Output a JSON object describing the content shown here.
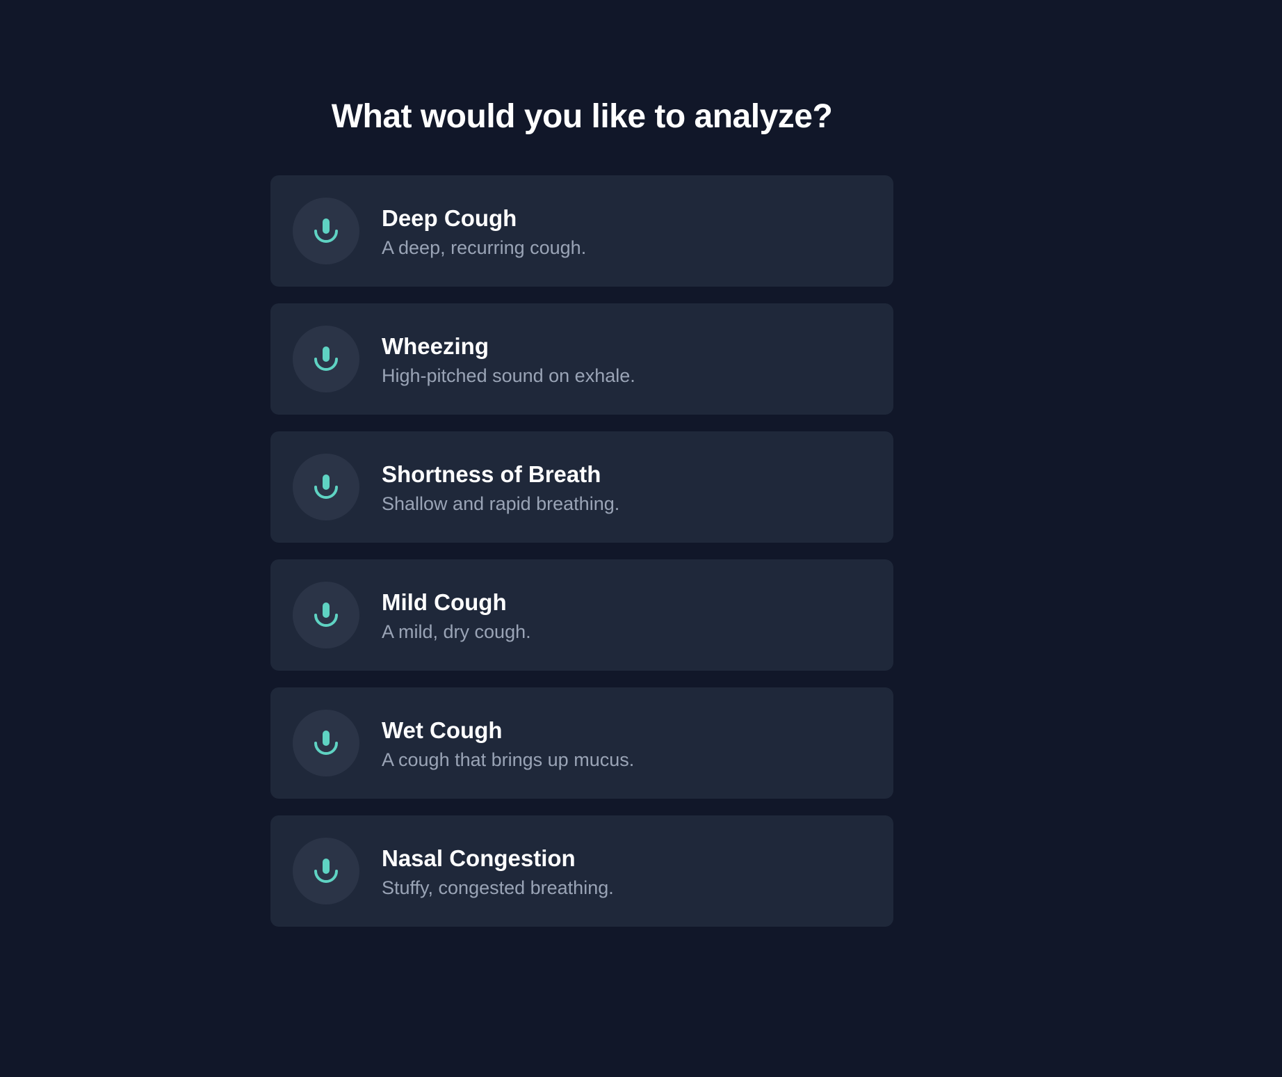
{
  "header": {
    "title": "What would you like to analyze?"
  },
  "options": [
    {
      "label": "Deep Cough",
      "description": "A deep, recurring cough.",
      "icon": "microphone-icon"
    },
    {
      "label": "Wheezing",
      "description": "High-pitched sound on exhale.",
      "icon": "microphone-icon"
    },
    {
      "label": "Shortness of Breath",
      "description": "Shallow and rapid breathing.",
      "icon": "microphone-icon"
    },
    {
      "label": "Mild Cough",
      "description": "A mild, dry cough.",
      "icon": "microphone-icon"
    },
    {
      "label": "Wet Cough",
      "description": "A cough that brings up mucus.",
      "icon": "microphone-icon"
    },
    {
      "label": "Nasal Congestion",
      "description": "Stuffy, congested breathing.",
      "icon": "microphone-icon"
    }
  ],
  "colors": {
    "background": "#111729",
    "card": "#1f283a",
    "icon_circle": "#2b3447",
    "accent": "#5fd3c3",
    "label": "#ffffff",
    "description": "#9aa4b6"
  }
}
